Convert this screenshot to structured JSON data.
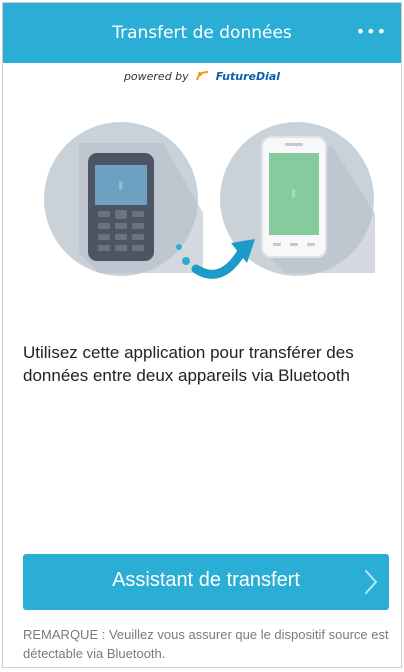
{
  "header": {
    "title": "Transfert de données",
    "menu_icon": "more-dots-icon",
    "menu_glyph": "•••"
  },
  "powered": {
    "prefix": "powered by",
    "brand": "FutureDial"
  },
  "illustration": {
    "left": "feature-phone-icon",
    "arrow": "transfer-arrow-icon",
    "right": "smartphone-icon"
  },
  "description": "Utilisez cette application pour transférer des données entre deux appareils via Bluetooth",
  "cta": {
    "label": "Assistant de transfert",
    "icon": "chevron-right-icon"
  },
  "note": "REMARQUE : Veuillez vous assurer que le dispositif source est détectable via Bluetooth.",
  "colors": {
    "accent": "#2aaed6",
    "circle": "#c9d1d9",
    "phone_dark": "#4d5564",
    "screen_blue": "#5f96b7",
    "screen_green": "#73c28f"
  }
}
